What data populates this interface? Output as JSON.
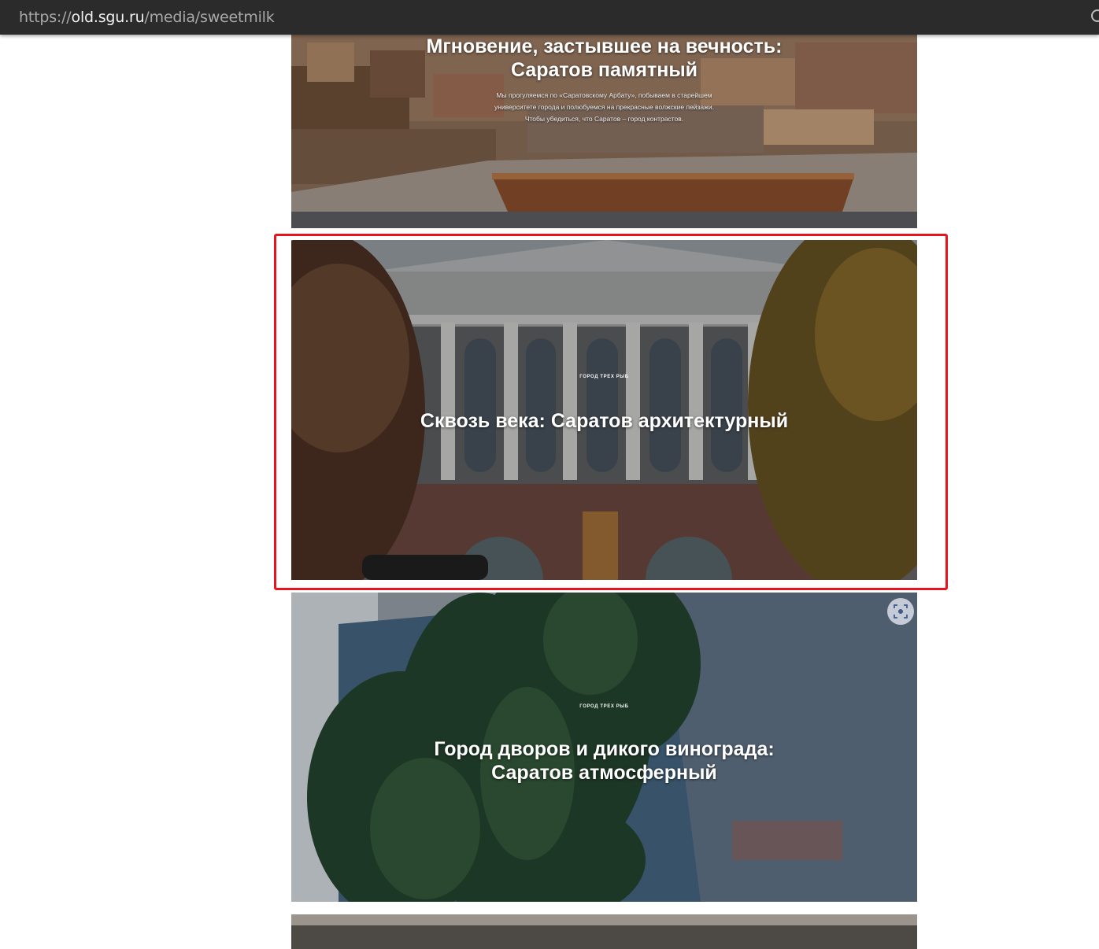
{
  "browser": {
    "url_scheme": "https://",
    "url_host": "old.sgu.ru",
    "url_path": "/media/sweetmilk"
  },
  "cards": [
    {
      "kicker": "",
      "title": "Мгновение, застывшее на вечность:\nСаратов памятный",
      "description": "Мы прогуляемся по «Саратовскому Арбату», побываем в старейшем университете города и полюбуемся на прекрасные волжские пейзажи. Чтобы убедиться, что Саратов – город контрастов."
    },
    {
      "kicker": "город трёх рыб",
      "title": "Сквозь века: Саратов архитектурный",
      "highlighted": true,
      "highlight_color": "#e8141b"
    },
    {
      "kicker": "город трёх рыб",
      "title": "Город дворов и дикого винограда:\nСаратов атмосферный",
      "icon": "visual-search-icon"
    },
    {
      "kicker": "",
      "title": ""
    }
  ]
}
